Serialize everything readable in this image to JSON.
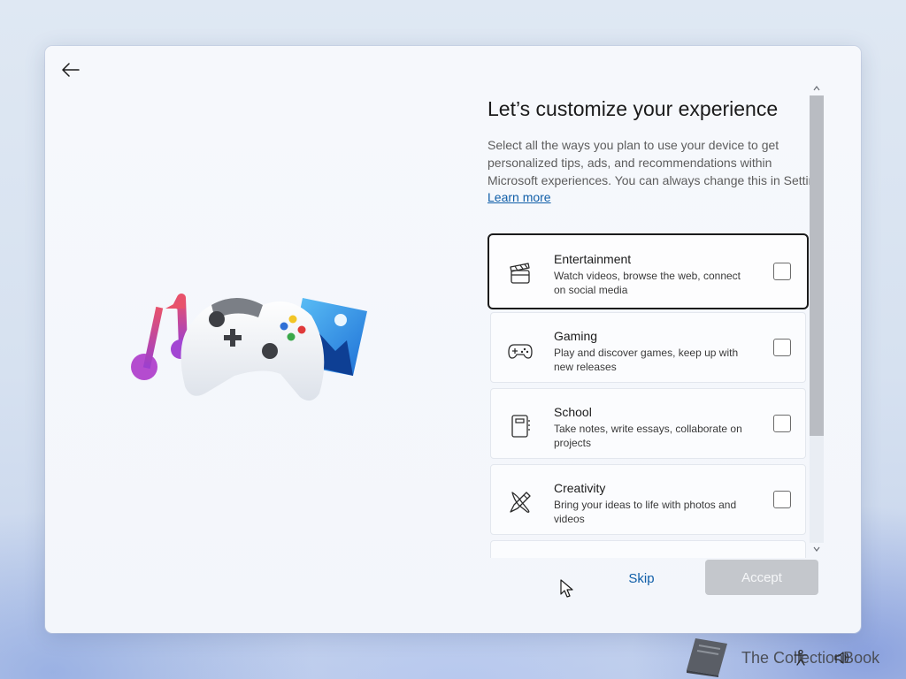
{
  "title": "Let’s customize your experience",
  "description_lines": [
    "Select all the ways you plan to use your device to get",
    "personalized tips, ads, and recommendations within",
    "Microsoft experiences. You can always change this in Settings."
  ],
  "learn_more": "Learn more",
  "options": [
    {
      "name": "Entertainment",
      "desc_lines": [
        "Watch videos, browse the web, connect",
        "on social media"
      ],
      "icon": "clapperboard-icon",
      "checked": false
    },
    {
      "name": "Gaming",
      "desc_lines": [
        "Play and discover games, keep up with",
        "new releases"
      ],
      "icon": "gamepad-icon",
      "checked": false
    },
    {
      "name": "School",
      "desc_lines": [
        "Take notes, write essays, collaborate on",
        "projects"
      ],
      "icon": "notebook-icon",
      "checked": false
    },
    {
      "name": "Creativity",
      "desc_lines": [
        "Bring your ideas to life with photos and",
        "videos"
      ],
      "icon": "brush-pencil-icon",
      "checked": false
    }
  ],
  "buttons": {
    "skip": "Skip",
    "accept": "Accept"
  },
  "watermark": {
    "text": "The CollectionBook"
  },
  "colors": {
    "accent": "#0f5ea8",
    "disabled_button": "#c4c7cc"
  }
}
